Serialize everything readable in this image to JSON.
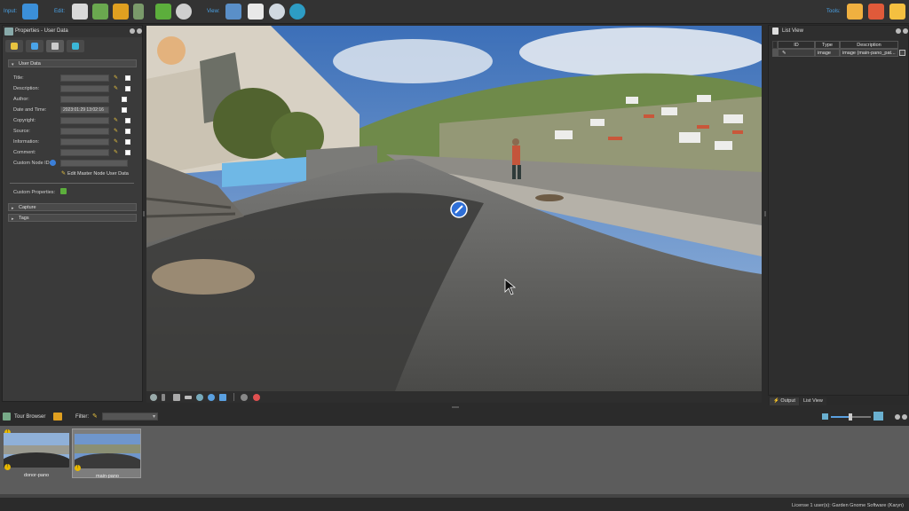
{
  "toolbar": {
    "input_label": "Input:",
    "edit_label": "Edit:",
    "view_label": "View:",
    "tools_label": "Tools:"
  },
  "properties": {
    "title": "Properties - User Data",
    "section_user_data": "User Data",
    "fields": [
      {
        "label": "Title:",
        "value": ""
      },
      {
        "label": "Description:",
        "value": ""
      },
      {
        "label": "Author:",
        "value": ""
      },
      {
        "label": "Date and Time:",
        "value": "2023:01:29 13:02:16"
      },
      {
        "label": "Copyright:",
        "value": ""
      },
      {
        "label": "Source:",
        "value": ""
      },
      {
        "label": "Information:",
        "value": ""
      },
      {
        "label": "Comment:",
        "value": ""
      }
    ],
    "custom_node_id_label": "Custom Node ID:",
    "edit_master_button": "Edit Master Node User Data",
    "custom_properties_label": "Custom Properties:",
    "section_capture": "Capture",
    "section_tags": "Tags"
  },
  "listview": {
    "title": "List View",
    "columns": [
      "ID",
      "Type",
      "Description"
    ],
    "rows": [
      {
        "id": "",
        "type": "image",
        "description": "image (main-pano_pat..."
      }
    ],
    "tab_output": "Output",
    "tab_listview": "List View"
  },
  "tour_browser": {
    "title": "Tour Browser",
    "filter_label": "Filter:",
    "items": [
      {
        "label": "donor-pano"
      },
      {
        "label": "main-pano"
      }
    ]
  },
  "status": {
    "license_text": "License 1 user(s): Garden Gnome Software (Karyn)"
  },
  "colors": {
    "accent_label": "#4aa3e8",
    "hotspot": "#2f6fd6",
    "warning": "#e8b800"
  }
}
